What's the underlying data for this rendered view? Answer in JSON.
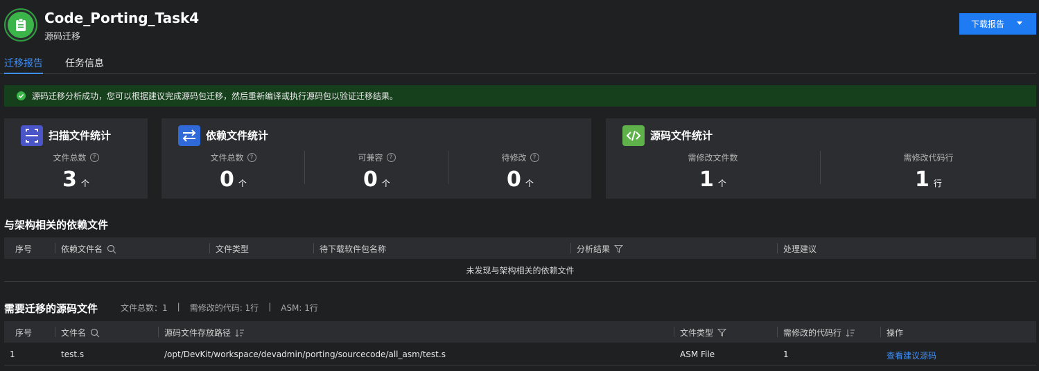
{
  "header": {
    "title": "Code_Porting_Task4",
    "subtitle": "源码迁移",
    "download_label": "下载报告"
  },
  "tabs": [
    {
      "label": "迁移报告",
      "active": true
    },
    {
      "label": "任务信息",
      "active": false
    }
  ],
  "alert": {
    "text": "源码迁移分析成功，您可以根据建议完成源码包迁移，然后重新编译或执行源码包以验证迁移结果。",
    "color": "#3bb54a"
  },
  "cards": {
    "scan": {
      "title": "扫描文件统计",
      "icon": "scan-icon",
      "stats": [
        {
          "label": "文件总数",
          "value": "3",
          "unit": "个"
        }
      ]
    },
    "dependency": {
      "title": "依赖文件统计",
      "icon": "swap-icon",
      "stats": [
        {
          "label": "文件总数",
          "value": "0",
          "unit": "个"
        },
        {
          "label": "可兼容",
          "value": "0",
          "unit": "个"
        },
        {
          "label": "待修改",
          "value": "0",
          "unit": "个"
        }
      ]
    },
    "source": {
      "title": "源码文件统计",
      "icon": "code-icon",
      "stats": [
        {
          "label": "需修改文件数",
          "value": "1",
          "unit": "个"
        },
        {
          "label": "需修改代码行",
          "value": "1",
          "unit": "行"
        }
      ]
    }
  },
  "dependency_table": {
    "title": "与架构相关的依赖文件",
    "columns": [
      "序号",
      "依赖文件名",
      "文件类型",
      "待下载软件包名称",
      "分析结果",
      "处理建议"
    ],
    "empty_text": "未发现与架构相关的依赖文件"
  },
  "source_table": {
    "title": "需要迁移的源码文件",
    "summary": {
      "total": "文件总数：1",
      "sep1": "|",
      "lines": "需修改的代码: 1行",
      "sep2": "|",
      "asm": "ASM: 1行"
    },
    "columns": [
      "序号",
      "文件名",
      "源码文件存放路径",
      "文件类型",
      "需修改的代码行",
      "操作"
    ],
    "rows": [
      {
        "index": "1",
        "name": "test.s",
        "path": "/opt/DevKit/workspace/devadmin/porting/sourcecode/all_asm/test.s",
        "type": "ASM File",
        "lines": "1",
        "action": "查看建议源码"
      }
    ]
  },
  "colors": {
    "accent": "#1f7bf2",
    "link": "#3d8ef7",
    "success": "#3bb54a",
    "background": "#1f2022",
    "card": "#2c2d30"
  }
}
